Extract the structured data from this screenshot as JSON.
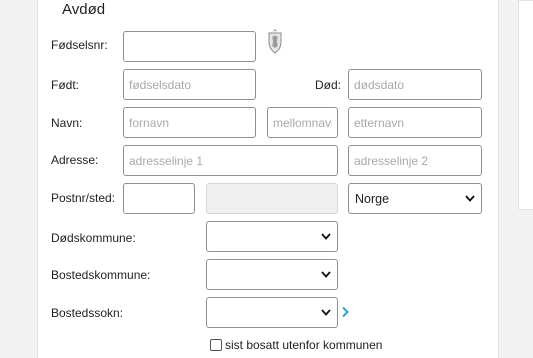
{
  "section": {
    "title": "Avdød"
  },
  "labels": {
    "fodselsnr": "Fødselsnr:",
    "fodt": "Født:",
    "dod": "Død:",
    "navn": "Navn:",
    "adresse": "Adresse:",
    "postnr_sted": "Postnr/sted:",
    "dodskommune": "Dødskommune:",
    "bostedskommune": "Bostedskommune:",
    "bostedssokn": "Bostedssokn:"
  },
  "fields": {
    "fodselsnr": {
      "value": "",
      "placeholder": ""
    },
    "fodselsdato": {
      "value": "",
      "placeholder": "fødselsdato"
    },
    "dodsdato": {
      "value": "",
      "placeholder": "dødsdato"
    },
    "fornavn": {
      "value": "",
      "placeholder": "fornavn"
    },
    "mellomnavn": {
      "value": "",
      "placeholder": "mellomnavn"
    },
    "etternavn": {
      "value": "",
      "placeholder": "etternavn"
    },
    "adresselinje1": {
      "value": "",
      "placeholder": "adresselinje 1"
    },
    "adresselinje2": {
      "value": "",
      "placeholder": "adresselinje 2"
    },
    "postnr": {
      "value": "",
      "placeholder": ""
    },
    "sted": {
      "value": "",
      "placeholder": ""
    }
  },
  "selects": {
    "land": {
      "selected": "Norge"
    },
    "dodskommune": {
      "selected": ""
    },
    "bostedskommune": {
      "selected": ""
    },
    "bostedssokn": {
      "selected": ""
    }
  },
  "checkbox": {
    "label": "sist bosatt utenfor kommunen",
    "checked": false
  },
  "icons": {
    "crest": "coat-of-arms-icon",
    "next": "chevron-right-icon"
  },
  "colors": {
    "accent": "#2aa9c6",
    "border": "#8f8f8f",
    "placeholder": "#a9a9a9"
  }
}
